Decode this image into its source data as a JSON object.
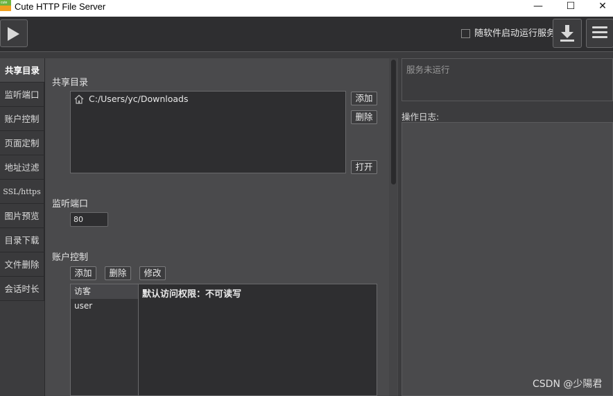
{
  "window": {
    "title": "Cute HTTP File Server",
    "icon_text": "cute",
    "minimize": "—",
    "maximize": "☐",
    "close": "✕"
  },
  "toolbar": {
    "autostart_label": "随软件启动运行服务",
    "autostart_checked": false
  },
  "sidebar": {
    "items": [
      {
        "label": "共享目录",
        "active": true
      },
      {
        "label": "监听端口"
      },
      {
        "label": "账户控制"
      },
      {
        "label": "页面定制"
      },
      {
        "label": "地址过滤"
      },
      {
        "label": "SSL/https"
      },
      {
        "label": "图片预览"
      },
      {
        "label": "目录下载"
      },
      {
        "label": "文件删除"
      },
      {
        "label": "会话时长"
      }
    ]
  },
  "shared_dir": {
    "heading": "共享目录",
    "paths": [
      "C:/Users/yc/Downloads"
    ],
    "add_button": "添加",
    "delete_button": "删除",
    "open_button": "打开"
  },
  "listen_port": {
    "heading": "监听端口",
    "value": "80"
  },
  "account": {
    "heading": "账户控制",
    "add_button": "添加",
    "delete_button": "删除",
    "edit_button": "修改",
    "users": [
      "访客",
      "user"
    ],
    "selected_index": 0,
    "permission_text": "默认访问权限：不可读写"
  },
  "status": {
    "text": "服务未运行"
  },
  "log": {
    "label": "操作日志:"
  },
  "watermark": "CSDN @少陽君"
}
